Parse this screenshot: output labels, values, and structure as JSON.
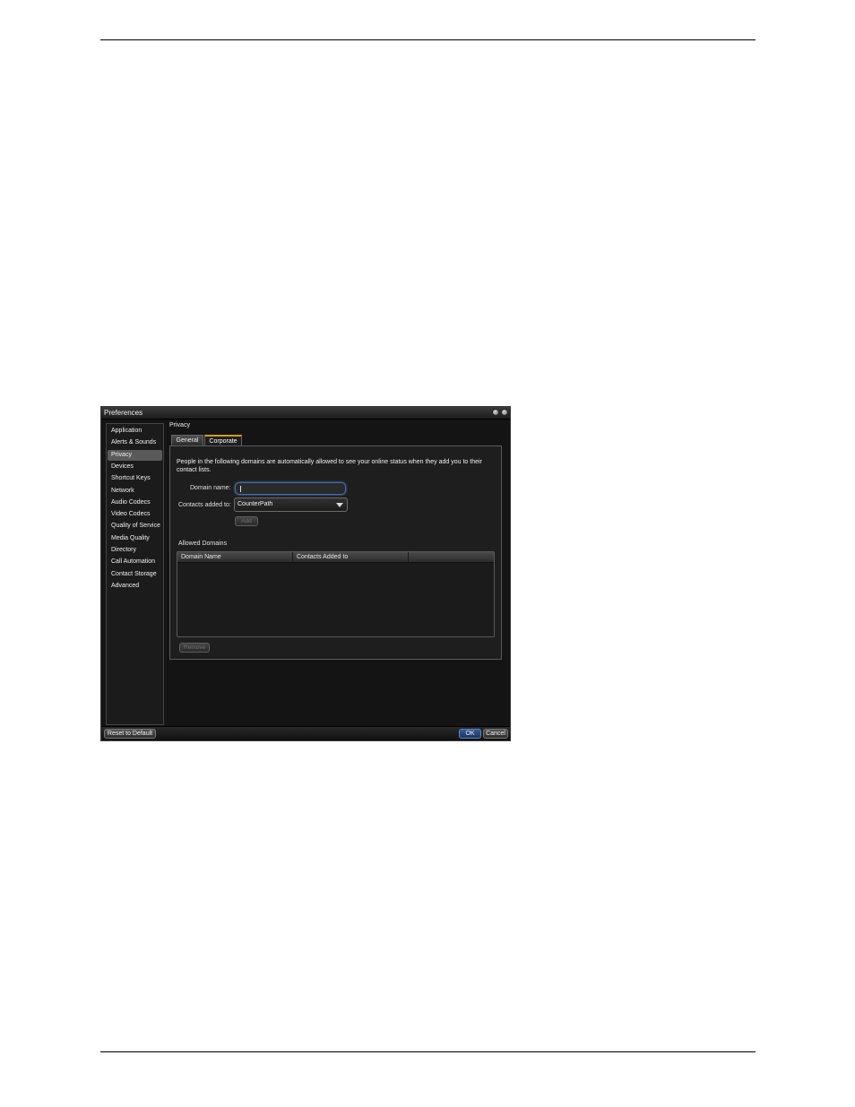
{
  "window": {
    "title": "Preferences"
  },
  "sidebar": {
    "items": [
      {
        "label": "Application"
      },
      {
        "label": "Alerts & Sounds"
      },
      {
        "label": "Privacy",
        "selected": true
      },
      {
        "label": "Devices"
      },
      {
        "label": "Shortcut Keys"
      },
      {
        "label": "Network"
      },
      {
        "label": "Audio Codecs"
      },
      {
        "label": "Video Codecs"
      },
      {
        "label": "Quality of Service"
      },
      {
        "label": "Media Quality"
      },
      {
        "label": "Directory"
      },
      {
        "label": "Call Automation"
      },
      {
        "label": "Contact Storage"
      },
      {
        "label": "Advanced"
      }
    ]
  },
  "main": {
    "section_title": "Privacy",
    "tabs": [
      {
        "label": "General"
      },
      {
        "label": "Corporate",
        "active": true
      }
    ],
    "corporate": {
      "description": "People in the following domains are automatically allowed to see your online status when they add you to their contact lists.",
      "domain_name_label": "Domain name:",
      "domain_name_value": "",
      "contacts_added_to_label": "Contacts added to:",
      "contacts_added_to_value": "CounterPath",
      "add_button": "Add",
      "allowed_domains_title": "Allowed Domains",
      "table_headers": [
        "Domain Name",
        "Contacts Added to",
        ""
      ],
      "rows": [],
      "remove_button": "Remove"
    }
  },
  "footer": {
    "reset_button": "Reset to Default",
    "ok_button": "OK",
    "cancel_button": "Cancel"
  },
  "colors": {
    "window_bg": "#141414",
    "active_tab_accent": "#d99a1e",
    "focus_blue": "#3d6fb0"
  },
  "icons": [
    "minimize-icon",
    "close-icon",
    "dropdown-arrow-icon"
  ]
}
